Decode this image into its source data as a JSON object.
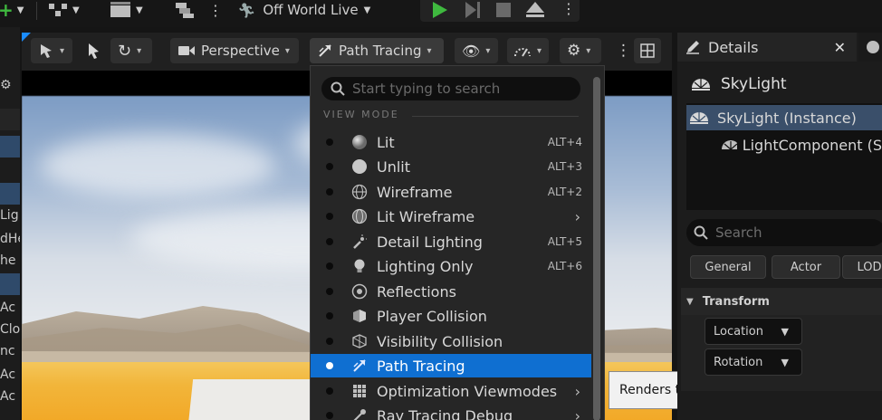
{
  "topbar": {
    "level_name": "Off World Live"
  },
  "left_strip": {
    "rows": [
      "Lig",
      "dHe",
      "he",
      "Ac",
      "Clo",
      "nc",
      "Ac",
      "Ac"
    ]
  },
  "viewport_toolbar": {
    "perspective_label": "Perspective",
    "view_mode_label": "Path Tracing"
  },
  "view_mode_menu": {
    "search_placeholder": "Start typing to search",
    "section_title": "VIEW MODE",
    "items": [
      {
        "label": "Lit",
        "shortcut": "ALT+4",
        "icon": "lit-sphere-icon"
      },
      {
        "label": "Unlit",
        "shortcut": "ALT+3",
        "icon": "unlit-sphere-icon"
      },
      {
        "label": "Wireframe",
        "shortcut": "ALT+2",
        "icon": "wireframe-globe-icon"
      },
      {
        "label": "Lit Wireframe",
        "shortcut": "",
        "icon": "lit-wireframe-icon"
      },
      {
        "label": "Detail Lighting",
        "shortcut": "ALT+5",
        "icon": "detail-lighting-icon"
      },
      {
        "label": "Lighting Only",
        "shortcut": "ALT+6",
        "icon": "light-bulb-icon"
      },
      {
        "label": "Reflections",
        "shortcut": "",
        "icon": "reflections-icon"
      },
      {
        "label": "Player Collision",
        "shortcut": "",
        "icon": "player-collision-icon"
      },
      {
        "label": "Visibility Collision",
        "shortcut": "",
        "icon": "visibility-collision-icon"
      },
      {
        "label": "Path Tracing",
        "shortcut": "",
        "icon": "path-tracing-icon"
      },
      {
        "label": "Optimization Viewmodes",
        "shortcut": "",
        "icon": "optimization-grid-icon"
      },
      {
        "label": "Ray Tracing Debug",
        "shortcut": "",
        "icon": "ray-tracing-debug-icon"
      }
    ],
    "selected": "Path Tracing"
  },
  "tooltip": {
    "text": "Renders the scene using a path tracer"
  },
  "details": {
    "tab_label": "Details",
    "actor_name": "SkyLight",
    "tree": [
      {
        "label": "SkyLight (Instance)"
      },
      {
        "label": "LightComponent (S"
      }
    ],
    "search_placeholder": "Search",
    "filters": [
      "General",
      "Actor",
      "LOD"
    ],
    "category": "Transform",
    "properties": [
      "Location",
      "Rotation"
    ]
  },
  "colors": {
    "accent": "#0f6fd1",
    "selection": "#3a4f6a",
    "play_green": "#3fb93f"
  }
}
